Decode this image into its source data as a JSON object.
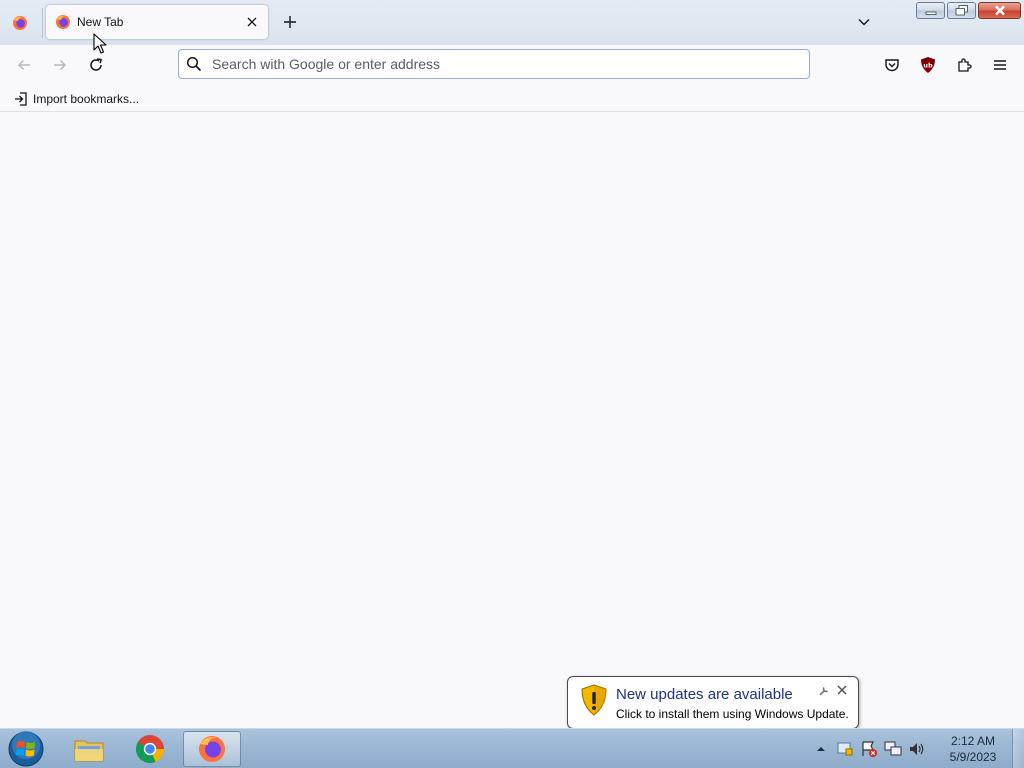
{
  "browser": {
    "tab": {
      "title": "New Tab"
    },
    "urlbar": {
      "placeholder": "Search with Google or enter address",
      "value": ""
    },
    "bookmarks_toolbar": {
      "import_label": "Import bookmarks..."
    },
    "toolbar_icons": [
      "back-icon",
      "forward-icon",
      "reload-icon",
      "pocket-icon",
      "ublock-origin-icon",
      "extensions-icon",
      "menu-icon"
    ]
  },
  "notification": {
    "title": "New updates are available",
    "text": "Click to install them using Windows Update."
  },
  "taskbar": {
    "apps": [
      "windows-explorer",
      "google-chrome",
      "firefox"
    ],
    "active_app": "firefox",
    "clock": {
      "time": "2:12 AM",
      "date": "5/9/2023"
    }
  },
  "colors": {
    "accent_focus": "#9ab0cf",
    "notification_title": "#1e3287",
    "taskbar": "#9bb7d3",
    "page_background": "#f9f9fb"
  }
}
